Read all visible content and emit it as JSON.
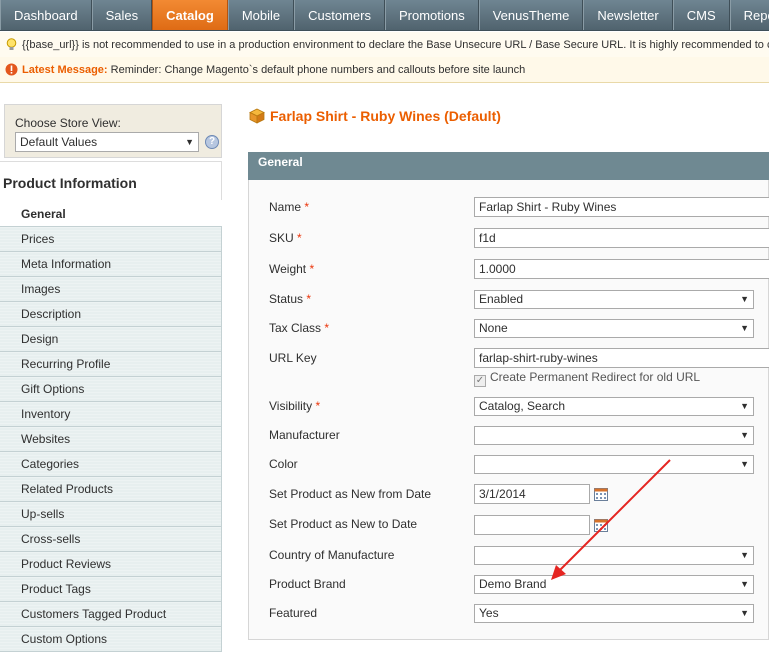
{
  "nav": {
    "items": [
      "Dashboard",
      "Sales",
      "Catalog",
      "Mobile",
      "Customers",
      "Promotions",
      "VenusTheme",
      "Newsletter",
      "CMS",
      "Reports"
    ],
    "active": "Catalog"
  },
  "messages": {
    "warning": "{{base_url}} is not recommended to use in a production environment to declare the Base Unsecure URL / Base Secure URL. It is highly recommended to change this value in your Magento configuration.",
    "latest_label": "Latest Message:",
    "latest_text": "Reminder: Change Magento`s default phone numbers and callouts before site launch"
  },
  "store_view": {
    "label": "Choose Store View:",
    "value": "Default Values",
    "help": "?"
  },
  "sidebar": {
    "title": "Product Information",
    "tabs": [
      "General",
      "Prices",
      "Meta Information",
      "Images",
      "Description",
      "Design",
      "Recurring Profile",
      "Gift Options",
      "Inventory",
      "Websites",
      "Categories",
      "Related Products",
      "Up-sells",
      "Cross-sells",
      "Product Reviews",
      "Product Tags",
      "Customers Tagged Product",
      "Custom Options"
    ]
  },
  "page": {
    "title": "Farlap Shirt - Ruby Wines (Default)"
  },
  "fieldset": {
    "title": "General",
    "fields": {
      "name": {
        "label": "Name",
        "value": "Farlap Shirt - Ruby Wines"
      },
      "sku": {
        "label": "SKU",
        "value": "f1d"
      },
      "weight": {
        "label": "Weight",
        "value": "1.0000"
      },
      "status": {
        "label": "Status",
        "value": "Enabled"
      },
      "tax_class": {
        "label": "Tax Class",
        "value": "None"
      },
      "url_key": {
        "label": "URL Key",
        "value": "farlap-shirt-ruby-wines",
        "redirect": "Create Permanent Redirect for old URL"
      },
      "visibility": {
        "label": "Visibility",
        "value": "Catalog, Search"
      },
      "manufacturer": {
        "label": "Manufacturer",
        "value": ""
      },
      "color": {
        "label": "Color",
        "value": ""
      },
      "news_from": {
        "label": "Set Product as New from Date",
        "value": "3/1/2014"
      },
      "news_to": {
        "label": "Set Product as New to Date",
        "value": ""
      },
      "country": {
        "label": "Country of Manufacture",
        "value": ""
      },
      "brand": {
        "label": "Product Brand",
        "value": "Demo Brand"
      },
      "featured": {
        "label": "Featured",
        "value": "Yes"
      }
    },
    "required_mark": "*"
  },
  "colors": {
    "accent": "#eb5e00",
    "nav_bg": "#5f7380",
    "annotation_arrow": "#e52521"
  }
}
